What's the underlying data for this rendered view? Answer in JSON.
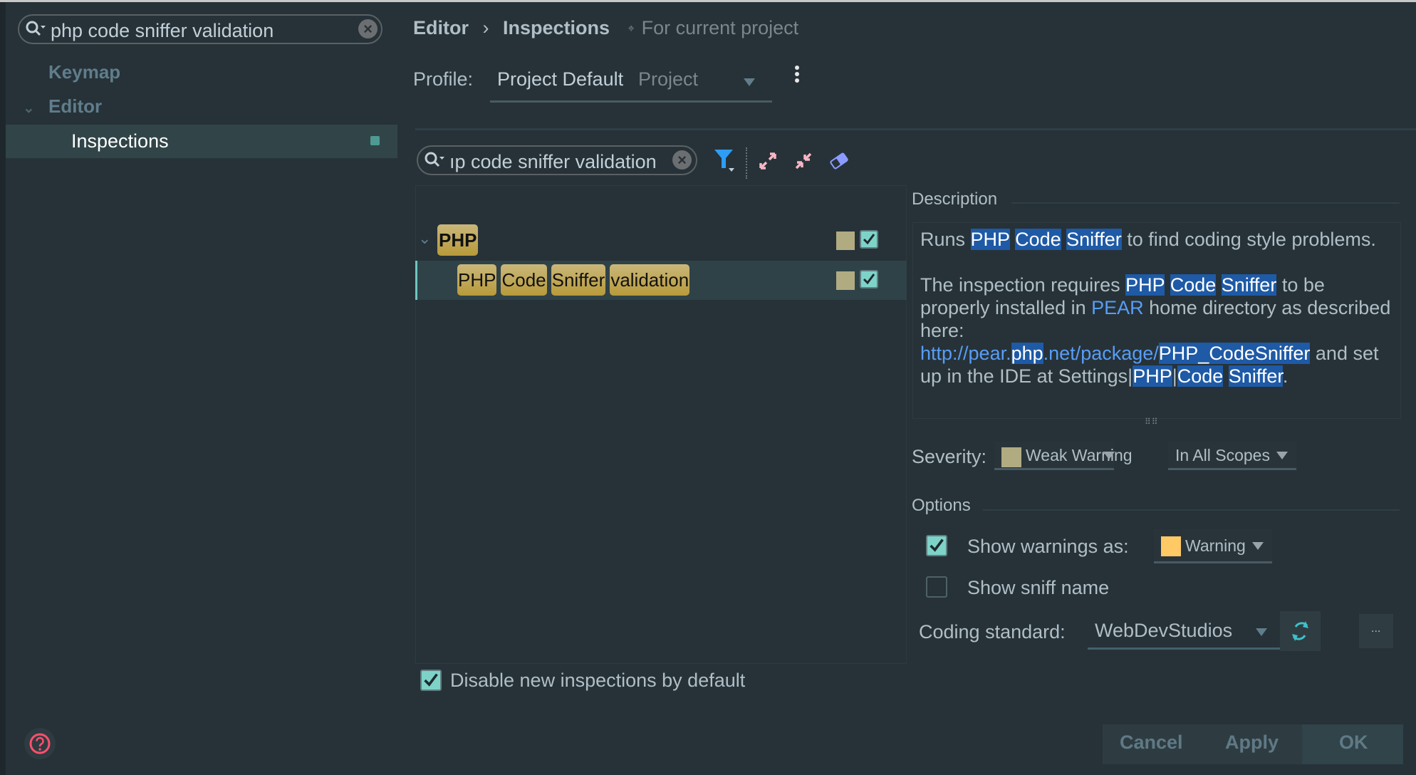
{
  "sidebar": {
    "search_value": "php code sniffer validation",
    "items": [
      {
        "label": "Keymap"
      },
      {
        "label": "Editor",
        "expanded": true
      },
      {
        "label": "Inspections",
        "selected": true,
        "icon": "profile-icon"
      }
    ]
  },
  "header": {
    "breadcrumb_parent": "Editor",
    "breadcrumb_separator": "›",
    "breadcrumb_current": "Inspections",
    "scope_note": "For current project",
    "scope_icon": "project-icon"
  },
  "profile": {
    "label": "Profile:",
    "value": "Project Default",
    "scope": "Project"
  },
  "inspection_search": {
    "value": "ıp code sniffer validation"
  },
  "toolbar": {
    "icons": [
      "filter-icon",
      "expand-all-icon",
      "collapse-all-icon",
      "reset-eraser-icon"
    ]
  },
  "tree": {
    "group": {
      "label": "PHP",
      "severity_color": "#b1ab82",
      "enabled": true
    },
    "items": [
      {
        "words": [
          "PHP",
          "Code",
          "Sniffer",
          "validation"
        ],
        "severity_color": "#b1ab82",
        "enabled": true,
        "selected": true
      }
    ]
  },
  "description": {
    "title": "Description",
    "para1": {
      "pre": "Runs ",
      "hl": [
        "PHP",
        "Code",
        "Sniffer"
      ],
      "post": " to find coding style problems."
    },
    "para2": {
      "pre": "The inspection requires ",
      "hl": [
        "PHP",
        "Code",
        "Sniffer"
      ],
      "mid": " to be properly installed in ",
      "pear_link": "PEAR",
      "post": " home directory as described here:",
      "url_a": "http://pear.",
      "url_b": "php",
      "url_c": ".net/package/",
      "url_d": "PHP_CodeSniffer",
      "after_url": " and set up in the IDE at Settings|",
      "s1": "PHP",
      "s_sep": "|",
      "s2": "Code",
      "s3": "Sniffer",
      "end": "."
    }
  },
  "severity": {
    "label": "Severity:",
    "value": "Weak Warning",
    "color": "#b1ab82",
    "scope": "In All Scopes"
  },
  "options": {
    "title": "Options",
    "show_warnings_as": {
      "label": "Show warnings as:",
      "checked": true,
      "value": "Warning",
      "color": "#ffc966"
    },
    "show_sniff_name": {
      "label": "Show sniff name",
      "checked": false
    },
    "coding_standard": {
      "label": "Coding standard:",
      "value": "WebDevStudios",
      "browse_label": "..."
    }
  },
  "disable_new": {
    "label": "Disable new inspections by default",
    "checked": true
  },
  "footer": {
    "cancel": "Cancel",
    "apply": "Apply",
    "ok": "OK"
  }
}
